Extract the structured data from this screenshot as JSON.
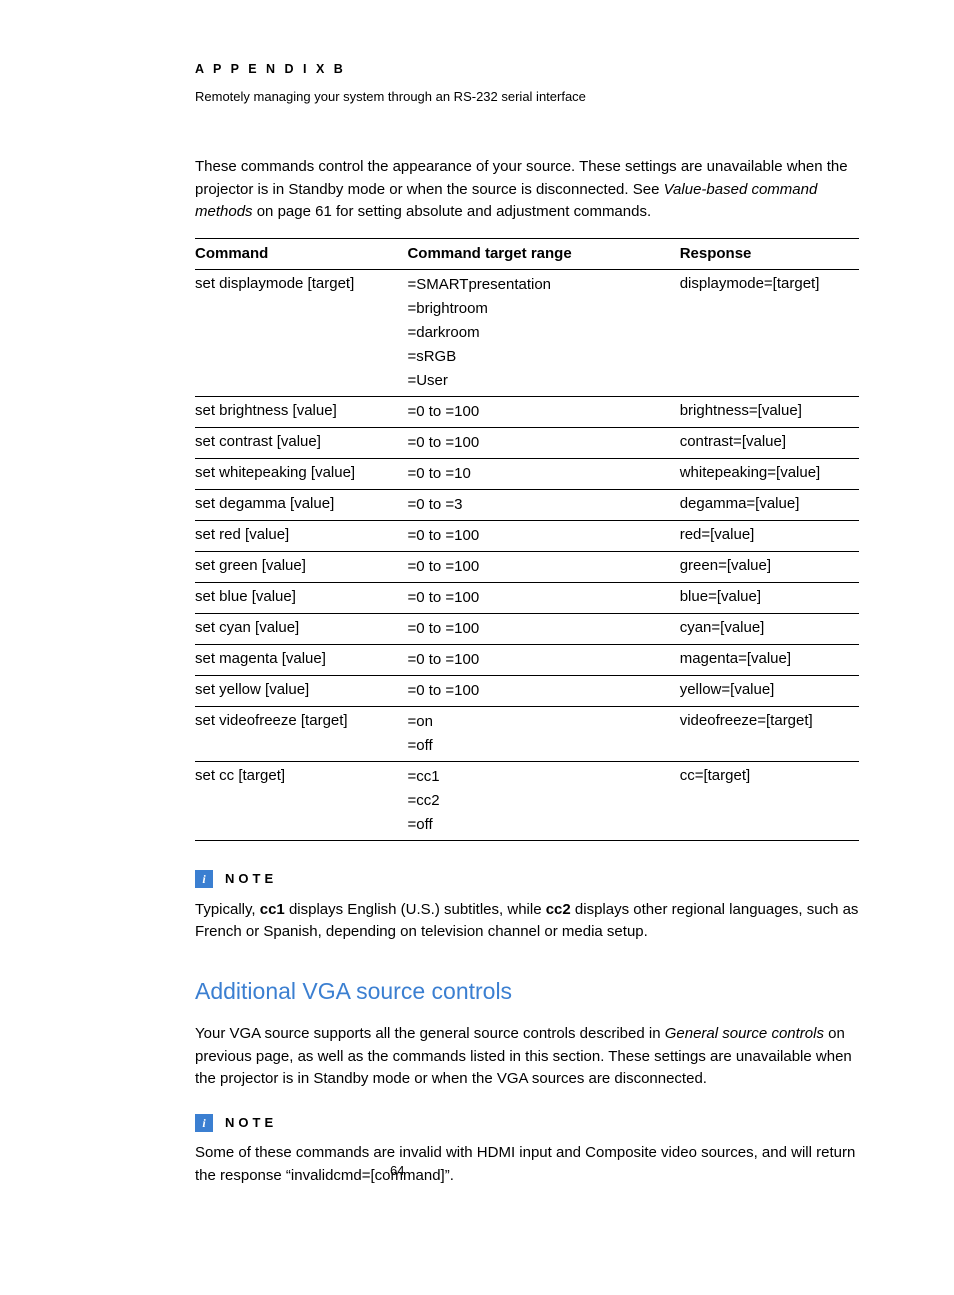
{
  "header": {
    "appendix": "A P P E N D I X   B",
    "subtitle": "Remotely managing your system through an RS-232 serial interface"
  },
  "intro": {
    "pre": "These commands control the appearance of your source. These settings are unavailable when the projector is in Standby mode or when the source is disconnected. See ",
    "link": "Value-based command methods",
    "post": " on page 61 for setting absolute and adjustment commands."
  },
  "table": {
    "h1": "Command",
    "h2": "Command target range",
    "h3": "Response",
    "rows": [
      {
        "cmd": "set displaymode [target]",
        "range": [
          "=SMARTpresentation",
          "=brightroom",
          "=darkroom",
          "=sRGB",
          "=User"
        ],
        "resp": "displaymode=[target]"
      },
      {
        "cmd": "set brightness [value]",
        "range": [
          "=0 to =100"
        ],
        "resp": "brightness=[value]"
      },
      {
        "cmd": "set contrast [value]",
        "range": [
          "=0 to =100"
        ],
        "resp": "contrast=[value]"
      },
      {
        "cmd": "set whitepeaking [value]",
        "range": [
          "=0 to =10"
        ],
        "resp": "whitepeaking=[value]"
      },
      {
        "cmd": "set degamma [value]",
        "range": [
          "=0 to =3"
        ],
        "resp": "degamma=[value]"
      },
      {
        "cmd": "set red [value]",
        "range": [
          "=0 to =100"
        ],
        "resp": "red=[value]"
      },
      {
        "cmd": "set green [value]",
        "range": [
          "=0 to =100"
        ],
        "resp": "green=[value]"
      },
      {
        "cmd": "set blue [value]",
        "range": [
          "=0 to =100"
        ],
        "resp": "blue=[value]"
      },
      {
        "cmd": "set cyan [value]",
        "range": [
          "=0 to =100"
        ],
        "resp": "cyan=[value]"
      },
      {
        "cmd": "set magenta [value]",
        "range": [
          "=0 to =100"
        ],
        "resp": "magenta=[value]"
      },
      {
        "cmd": "set yellow [value]",
        "range": [
          "=0 to =100"
        ],
        "resp": "yellow=[value]"
      },
      {
        "cmd": "set videofreeze [target]",
        "range": [
          "=on",
          "=off"
        ],
        "resp": "videofreeze=[target]"
      },
      {
        "cmd": "set cc [target]",
        "range": [
          "=cc1",
          "=cc2",
          "=off"
        ],
        "resp": "cc=[target]"
      }
    ]
  },
  "note1": {
    "label": "NOTE",
    "pre": "Typically, ",
    "b1": "cc1",
    "mid1": " displays English (U.S.) subtitles, while ",
    "b2": "cc2",
    "post": " displays other regional languages, such as French or Spanish, depending on television channel or media setup."
  },
  "section": {
    "heading": "Additional VGA source controls",
    "pre": "Your VGA source supports all the general source controls described in ",
    "link": "General source controls",
    "post": " on previous page, as well as the commands listed in this section. These settings are unavailable when the projector is in Standby mode or when the VGA sources are disconnected."
  },
  "note2": {
    "label": "NOTE",
    "body": "Some of these commands are invalid with HDMI input and Composite video sources, and will return the response “invalidcmd=[command]”."
  },
  "page": "64"
}
